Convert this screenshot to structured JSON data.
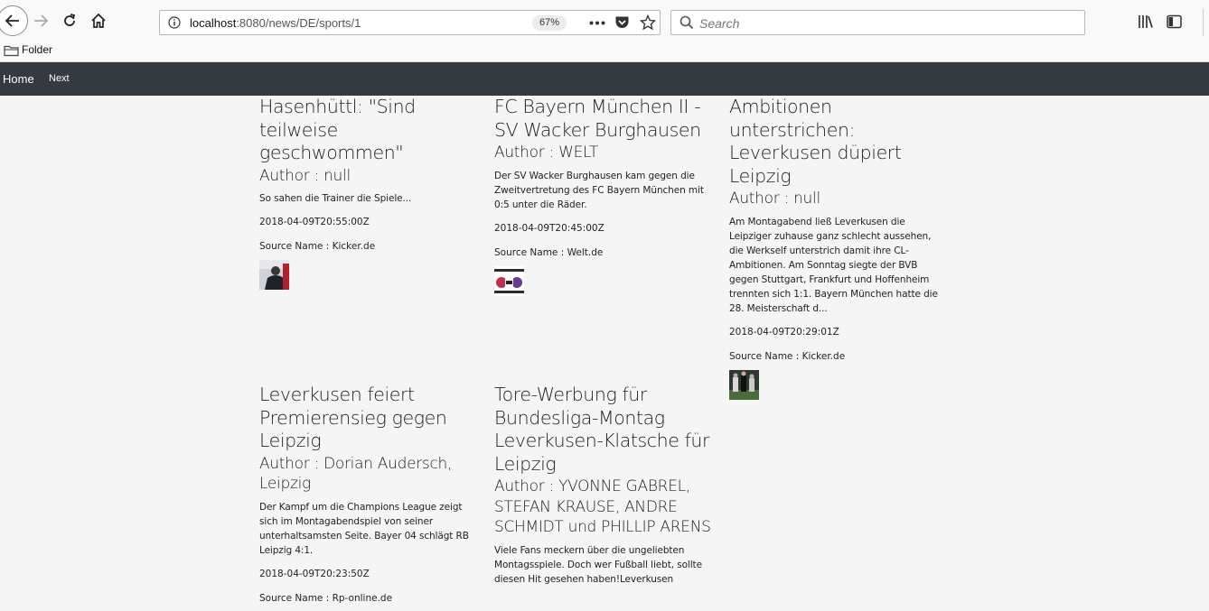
{
  "browser": {
    "url_host": "localhost",
    "url_rest": ":8080/news/DE/sports/1",
    "zoom": "67%",
    "search_placeholder": "Search",
    "bookmark_folder": "Folder"
  },
  "nav": {
    "home": "Home",
    "next": "Next"
  },
  "articles": [
    {
      "title": "Hasenhüttl: \"Sind teilweise geschwommen\"",
      "author": "Author : null",
      "description": "So sahen die Trainer die Spiele...",
      "date": "2018-04-09T20:55:00Z",
      "source": "Source Name : Kicker.de"
    },
    {
      "title": "FC Bayern München II - SV Wacker Burghausen",
      "author": "Author : WELT",
      "description": "Der SV Wacker Burghausen kam gegen die Zweitvertretung des FC Bayern München mit 0:5 unter die Räder.",
      "date": "2018-04-09T20:45:00Z",
      "source": "Source Name : Welt.de"
    },
    {
      "title": "Ambitionen unterstrichen: Leverkusen düpiert Leipzig",
      "author": "Author : null",
      "description": "Am Montagabend ließ Leverkusen die Leipziger zuhause ganz schlecht aussehen, die Werkself unterstrich damit ihre CL-Ambitionen. Am Sonntag siegte der BVB gegen Stuttgart, Frankfurt und Hoffenheim trennten sich 1:1. Bayern München hatte die 28. Meisterschaft d...",
      "date": "2018-04-09T20:29:01Z",
      "source": "Source Name : Kicker.de"
    },
    {
      "title": "Leverkusen feiert Premierensieg gegen Leipzig",
      "author": "Author : Dorian Audersch, Leipzig",
      "description": "Der Kampf um die Champions League zeigt sich im Montagabendspiel von seiner unterhaltsamsten Seite. Bayer 04 schlägt RB Leipzig 4:1.",
      "date": "2018-04-09T20:23:50Z",
      "source": "Source Name : Rp-online.de"
    },
    {
      "title": "Tore-Werbung für Bundesliga-Montag Leverkusen-Klatsche für Leipzig",
      "author": "Author : YVONNE GABREL, STEFAN KRAUSE, ANDRE SCHMIDT und PHILLIP ARENS",
      "description": "Viele Fans meckern über die ungeliebten Montagsspiele. Doch wer Fußball liebt, sollte diesen Hit gesehen haben!Leverkusen"
    }
  ]
}
